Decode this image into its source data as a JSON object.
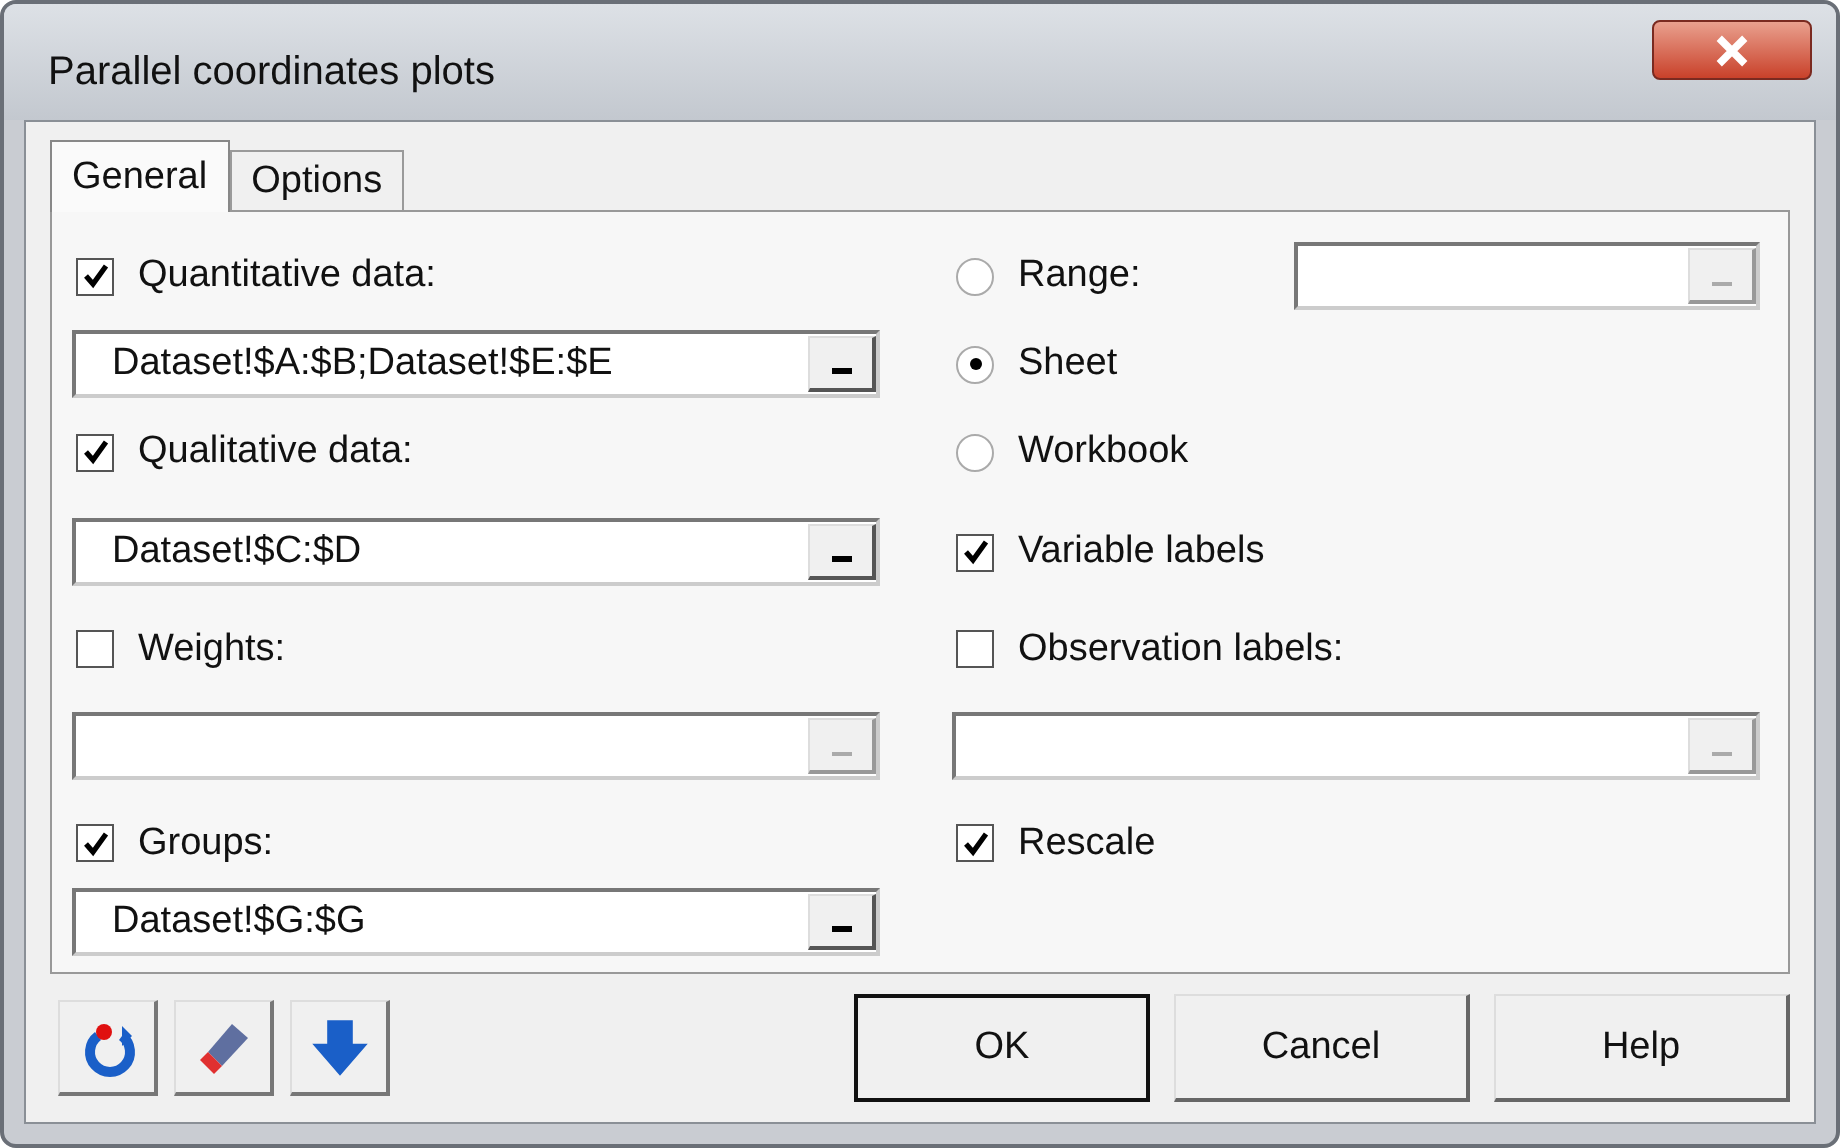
{
  "window": {
    "title": "Parallel coordinates plots"
  },
  "tabs": [
    {
      "label": "General",
      "selected": true
    },
    {
      "label": "Options",
      "selected": false
    }
  ],
  "left": [
    {
      "kind": "checkbox",
      "label": "Quantitative data:",
      "checked": true
    },
    {
      "kind": "field",
      "value": "Dataset!$A:$B;Dataset!$E:$E",
      "disabled": false
    },
    {
      "kind": "checkbox",
      "label": "Qualitative data:",
      "checked": true
    },
    {
      "kind": "field",
      "value": "Dataset!$C:$D",
      "disabled": false
    },
    {
      "kind": "checkbox",
      "label": "Weights:",
      "checked": false
    },
    {
      "kind": "field",
      "disabled": true
    },
    {
      "kind": "checkbox",
      "label": "Groups:",
      "checked": true
    },
    {
      "kind": "field",
      "value": "Dataset!$G:$G",
      "disabled": false
    }
  ],
  "right": [
    {
      "kind": "radio",
      "label": "Range:",
      "selected": false,
      "field": {
        "disabled": true
      }
    },
    {
      "kind": "radio",
      "label": "Sheet",
      "selected": true
    },
    {
      "kind": "radio",
      "label": "Workbook",
      "selected": false
    },
    {
      "kind": "checkbox",
      "label": "Variable labels",
      "checked": true
    },
    {
      "kind": "checkbox",
      "label": "Observation labels:",
      "checked": false
    },
    {
      "kind": "field",
      "disabled": true
    },
    {
      "kind": "checkbox",
      "label": "Rescale",
      "checked": true
    }
  ],
  "buttons": [
    {
      "label": "OK"
    },
    {
      "label": "Cancel"
    },
    {
      "label": "Help"
    }
  ]
}
